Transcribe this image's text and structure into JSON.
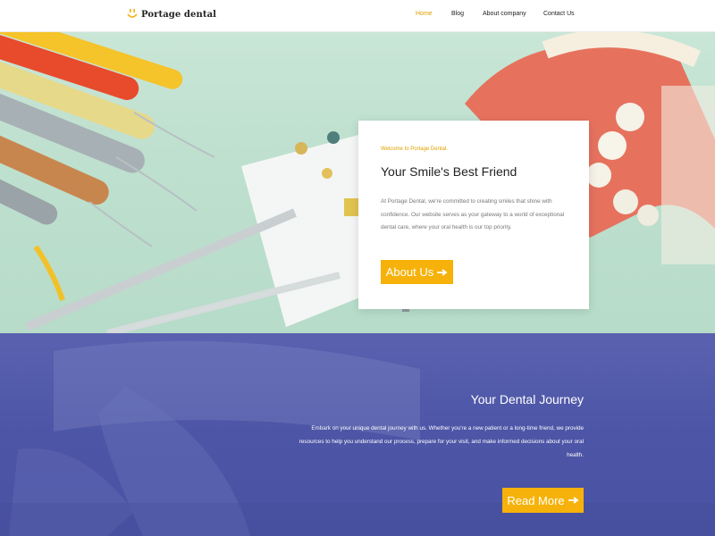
{
  "header": {
    "logo_text": "Portage dental",
    "logo_icon": "smile-icon",
    "nav": [
      {
        "label": "Home",
        "active": true
      },
      {
        "label": "Blog",
        "active": false
      },
      {
        "label": "About company",
        "active": false
      },
      {
        "label": "Contact Us",
        "active": false
      }
    ]
  },
  "hero": {
    "eyebrow": "Welcome to Portage Dental.",
    "title": "Your Smile's Best Friend",
    "body": "At Portage Dental, we're committed to creating smiles that shine with confidence. Our website serves as your gateway to a world of exceptional dental care, where your oral health is our top priority.",
    "button_label": "About Us",
    "button_icon": "arrow-right-icon"
  },
  "journey": {
    "title": "Your Dental Journey",
    "body": "Embark on your unique dental journey with us. Whether you're a new patient or a long-time friend, we provide resources to help you understand our process, prepare for your visit, and make informed decisions about your oral health.",
    "button_label": "Read More",
    "button_icon": "arrow-right-icon"
  },
  "colors": {
    "accent": "#f6b20a",
    "journey_overlay": "#4c55a6",
    "hero_background": "#c9e6d6"
  }
}
